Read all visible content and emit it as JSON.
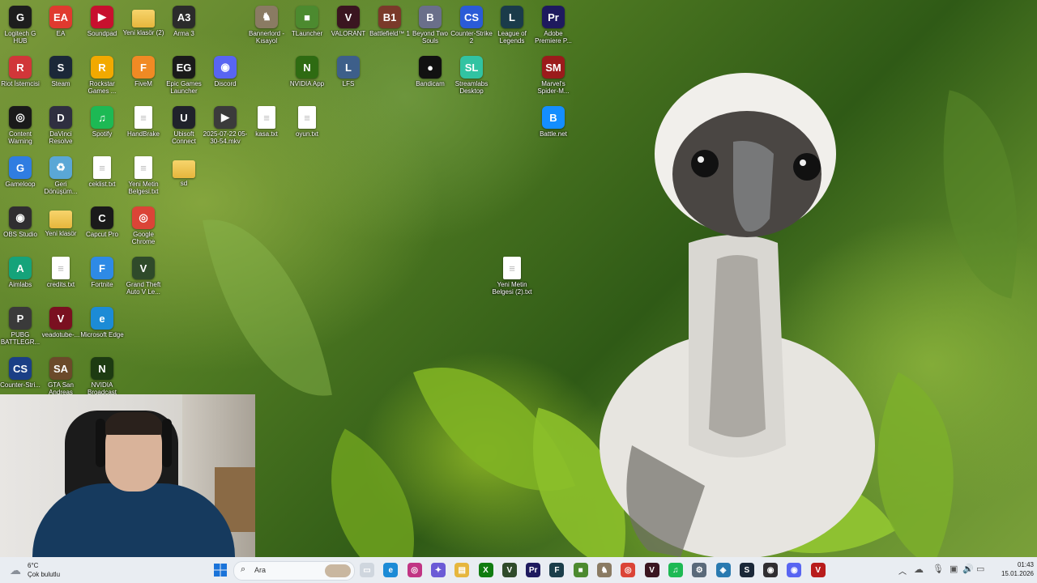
{
  "desktop": {
    "icons": [
      {
        "label": "Logitech G HUB",
        "glyph": "G",
        "color": "#1d1d1d"
      },
      {
        "label": "EA",
        "glyph": "EA",
        "color": "#e03a2f"
      },
      {
        "label": "Soundpad",
        "glyph": "▶",
        "color": "#c8102e"
      },
      {
        "label": "Yeni klasör (2)",
        "glyph": "",
        "color": "folder"
      },
      {
        "label": "Arma 3",
        "glyph": "A3",
        "color": "#2b2b2b"
      },
      {
        "label": "Bannerlord - Kısayol",
        "glyph": "♞",
        "color": "#8a7b63"
      },
      {
        "label": "TLauncher",
        "glyph": "■",
        "color": "#4c8a2f"
      },
      {
        "label": "VALORANT",
        "glyph": "V",
        "color": "#3a1520"
      },
      {
        "label": "Battlefield™ 1",
        "glyph": "B1",
        "color": "#7a3a2a"
      },
      {
        "label": "Beyond Two Souls",
        "glyph": "B",
        "color": "#6a6f8a"
      },
      {
        "label": "Counter-Strike 2",
        "glyph": "CS",
        "color": "#2a5bd7"
      },
      {
        "label": "League of Legends",
        "glyph": "L",
        "color": "#1a3b4a"
      },
      {
        "label": "Adobe Premiere P...",
        "glyph": "Pr",
        "color": "#1e1a5e"
      },
      {
        "label": "Riot İstemcisi",
        "glyph": "R",
        "color": "#d13639"
      },
      {
        "label": "Steam",
        "glyph": "S",
        "color": "#1b2838"
      },
      {
        "label": "Rockstar Games ...",
        "glyph": "R",
        "color": "#f2a900"
      },
      {
        "label": "FiveM",
        "glyph": "F",
        "color": "#f08a24"
      },
      {
        "label": "Epic Games Launcher",
        "glyph": "EG",
        "color": "#1a1a1a"
      },
      {
        "label": "Discord",
        "glyph": "◉",
        "color": "#5865f2"
      },
      {
        "label": "NVIDIA App",
        "glyph": "N",
        "color": "#2e6b12"
      },
      {
        "label": "LFS",
        "glyph": "L",
        "color": "#3d5f8a"
      },
      {
        "label": "Bandicam",
        "glyph": "●",
        "color": "#111111"
      },
      {
        "label": "Streamlabs Desktop",
        "glyph": "SL",
        "color": "#31c3a2"
      },
      {
        "label": "Marvel's Spider-M...",
        "glyph": "SM",
        "color": "#9b1b1b"
      },
      {
        "label": "Content Warning",
        "glyph": "◎",
        "color": "#1a1a1a"
      },
      {
        "label": "DaVinci Resolve",
        "glyph": "D",
        "color": "#2f2f40"
      },
      {
        "label": "Spotify",
        "glyph": "♫",
        "color": "#1db954"
      },
      {
        "label": "HandBrake",
        "glyph": "",
        "color": "doc"
      },
      {
        "label": "Ubisoft Connect",
        "glyph": "U",
        "color": "#20222b"
      },
      {
        "label": "2025-07-22 05-30-54.mkv",
        "glyph": "▶",
        "color": "#3b3b3b"
      },
      {
        "label": "kasa.txt",
        "glyph": "",
        "color": "doc"
      },
      {
        "label": "oyun.txt",
        "glyph": "",
        "color": "doc"
      },
      {
        "label": "Battle.net",
        "glyph": "B",
        "color": "#148eff"
      },
      {
        "label": "Gameloop",
        "glyph": "G",
        "color": "#2f7de1"
      },
      {
        "label": "Geri Dönüşüm...",
        "glyph": "♻",
        "color": "#5aa7d6"
      },
      {
        "label": "ceklist.txt",
        "glyph": "",
        "color": "doc"
      },
      {
        "label": "Yeni Metin Belgesi.txt",
        "glyph": "",
        "color": "doc"
      },
      {
        "label": "sd",
        "glyph": "",
        "color": "folder"
      },
      {
        "label": "OBS Studio",
        "glyph": "◉",
        "color": "#302e31"
      },
      {
        "label": "Yeni klasör",
        "glyph": "",
        "color": "folder"
      },
      {
        "label": "Capcut Pro",
        "glyph": "C",
        "color": "#1a1a1a"
      },
      {
        "label": "Google Chrome",
        "glyph": "◎",
        "color": "#db4437"
      },
      {
        "label": "Aimlabs",
        "glyph": "A",
        "color": "#15a37a"
      },
      {
        "label": "credits.txt",
        "glyph": "",
        "color": "doc"
      },
      {
        "label": "Fortnite",
        "glyph": "F",
        "color": "#2e8ae6"
      },
      {
        "label": "Grand Theft Auto V Le...",
        "glyph": "V",
        "color": "#2f4a2a"
      },
      {
        "label": "Yeni Metin Belgesi (2).txt",
        "glyph": "",
        "color": "doc"
      },
      {
        "label": "PUBG BATTLEGR...",
        "glyph": "P",
        "color": "#3a3a3a"
      },
      {
        "label": "veadotube-...",
        "glyph": "V",
        "color": "#7a1020"
      },
      {
        "label": "Microsoft Edge",
        "glyph": "e",
        "color": "#1c8bd6"
      },
      {
        "label": "Counter-Stri...",
        "glyph": "CS",
        "color": "#1b3f86"
      },
      {
        "label": "GTA San Andreas",
        "glyph": "SA",
        "color": "#6b4a2a"
      },
      {
        "label": "NVIDIA Broadcast",
        "glyph": "N",
        "color": "#1d3b12"
      }
    ]
  },
  "taskbar": {
    "weather_temp": "6°C",
    "weather_desc": "Çok bulutlu",
    "search_placeholder": "Ara",
    "clock_time": "01:43",
    "clock_date": "15.01.2026",
    "apps": [
      {
        "name": "task-view",
        "glyph": "▭",
        "color": "#cfd6de"
      },
      {
        "name": "edge",
        "glyph": "e",
        "color": "#1c8bd6"
      },
      {
        "name": "instagram",
        "glyph": "◎",
        "color": "#c13584"
      },
      {
        "name": "copilot",
        "glyph": "✦",
        "color": "#6b5bd6"
      },
      {
        "name": "file-explorer",
        "glyph": "▤",
        "color": "#e6b63d"
      },
      {
        "name": "xbox",
        "glyph": "X",
        "color": "#107c10"
      },
      {
        "name": "gta",
        "glyph": "V",
        "color": "#2f4a2a"
      },
      {
        "name": "premiere",
        "glyph": "Pr",
        "color": "#1e1a5e"
      },
      {
        "name": "fivem",
        "glyph": "F",
        "color": "#1b3e4a"
      },
      {
        "name": "minecraft",
        "glyph": "■",
        "color": "#4c8a2f"
      },
      {
        "name": "bannerlord",
        "glyph": "♞",
        "color": "#8a7b63"
      },
      {
        "name": "chrome",
        "glyph": "◎",
        "color": "#db4437"
      },
      {
        "name": "valorant",
        "glyph": "V",
        "color": "#3a1520"
      },
      {
        "name": "spotify",
        "glyph": "♫",
        "color": "#1db954"
      },
      {
        "name": "settings",
        "glyph": "⚙",
        "color": "#5a6a7a"
      },
      {
        "name": "vpn",
        "glyph": "◈",
        "color": "#2a7ab0"
      },
      {
        "name": "steam",
        "glyph": "S",
        "color": "#1b2838"
      },
      {
        "name": "obs",
        "glyph": "◉",
        "color": "#302e31"
      },
      {
        "name": "discord",
        "glyph": "◉",
        "color": "#5865f2"
      },
      {
        "name": "red-app",
        "glyph": "V",
        "color": "#b81c1c"
      }
    ]
  }
}
